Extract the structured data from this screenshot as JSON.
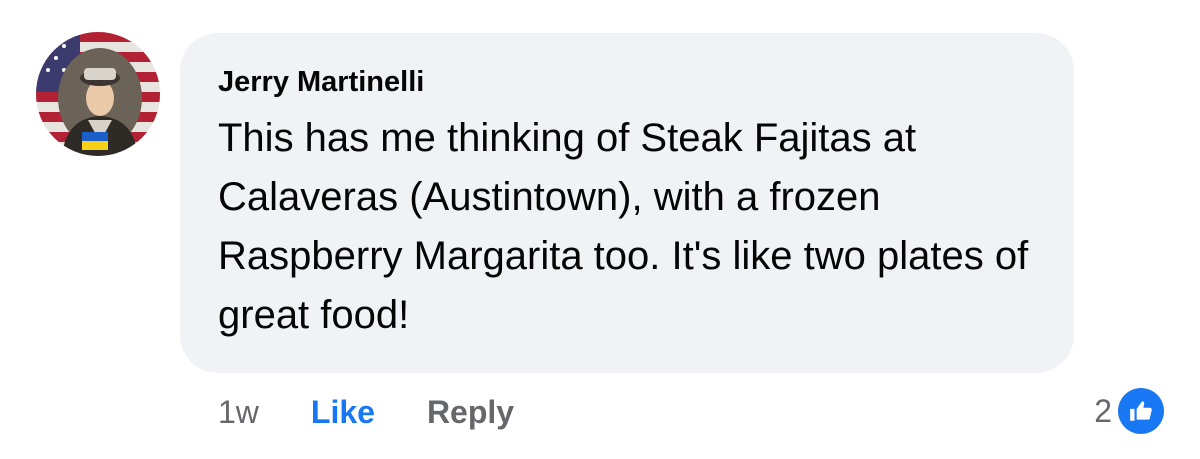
{
  "comment": {
    "author": "Jerry Martinelli",
    "text": "This has me thinking of Steak Fajitas at Calaveras (Austintown), with a frozen Raspberry Margarita too. It's like two plates of great food!",
    "timestamp": "1w",
    "actions": {
      "like_label": "Like",
      "reply_label": "Reply"
    },
    "reactions": {
      "count": "2",
      "icon": "thumbs-up-icon"
    }
  },
  "colors": {
    "bubble": "#f0f2f5",
    "like_blue": "#1877f2",
    "secondary_text": "#65676b",
    "primary_text": "#050505"
  }
}
